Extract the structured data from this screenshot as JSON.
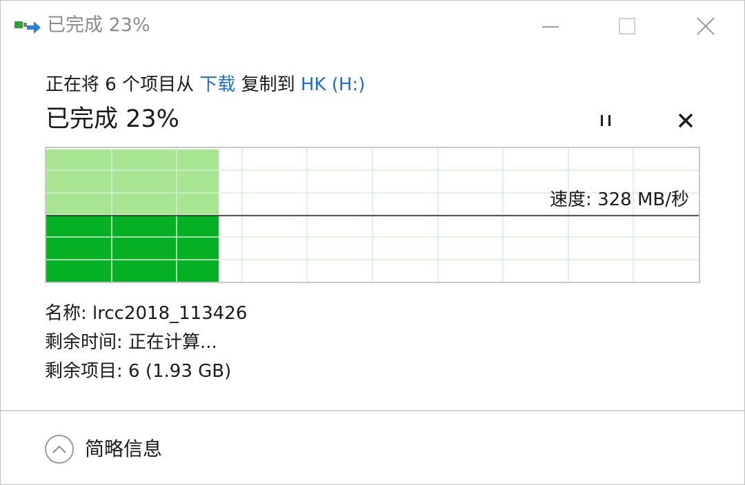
{
  "window": {
    "title": "已完成 23%",
    "icon": "copy-transfer-icon"
  },
  "header": {
    "prefix": "正在将 6 个项目从 ",
    "source": "下载",
    "middle": " 复制到 ",
    "destination": "HK (H:)"
  },
  "status": {
    "title": "已完成 23%",
    "pause_icon": "pause-icon",
    "cancel_icon": "close-icon"
  },
  "graph": {
    "progress": 0.23,
    "speed_label": "速度: 328 MB/秒",
    "colors": {
      "done_fill": "#06b025",
      "history_fill": "#a8e592",
      "grid": "#d6efd6",
      "speed_line": "#222222"
    }
  },
  "details": {
    "name": "名称: lrcc2018_113426",
    "time_remaining": "剩余时间: 正在计算...",
    "items_remaining": "剩余项目: 6 (1.93 GB)"
  },
  "footer": {
    "toggle_label": "简略信息",
    "toggle_icon": "chevron-up-icon"
  },
  "colors": {
    "link": "#1e6fc8",
    "title_gray": "#8a8a8a"
  }
}
